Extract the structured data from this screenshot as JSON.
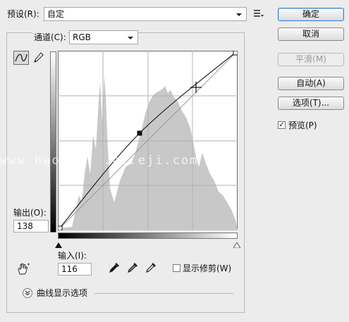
{
  "preset": {
    "label": "预设(R):",
    "value": "自定"
  },
  "buttons": {
    "ok": "确定",
    "cancel": "取消",
    "smooth": "平滑(M)",
    "auto": "自动(A)",
    "options": "选项(T)..."
  },
  "preview": {
    "label": "预览(P)",
    "checked": true
  },
  "channel": {
    "label": "通道(C):",
    "value": "RGB"
  },
  "output": {
    "label": "输出(O):",
    "value": "138"
  },
  "input": {
    "label": "输入(I):",
    "value": "116"
  },
  "show_clipping": {
    "label": "显示修剪(W)",
    "checked": false
  },
  "curve_options": {
    "label": "曲线显示选项"
  },
  "watermark": "www.hao ... .c..eji.com",
  "curve": {
    "points": [
      {
        "input": 0,
        "output": 0
      },
      {
        "input": 116,
        "output": 138
      },
      {
        "input": 255,
        "output": 255
      }
    ],
    "active_point": {
      "input": 116,
      "output": 138
    }
  },
  "icons": {
    "preset_menu": "list-menu-icon",
    "curve_tool": "curve-point-tool-icon",
    "pencil_tool": "pencil-icon",
    "hand_tool": "hand-adjust-icon",
    "black_eyedropper": "eyedropper-black-icon",
    "gray_eyedropper": "eyedropper-gray-icon",
    "white_eyedropper": "eyedropper-white-icon",
    "expand": "chevron-down-circle-icon"
  },
  "colors": {
    "graph_bg": "#ffffff",
    "histogram": "#c8c8c8",
    "accent_border": "#3d7bd4"
  }
}
